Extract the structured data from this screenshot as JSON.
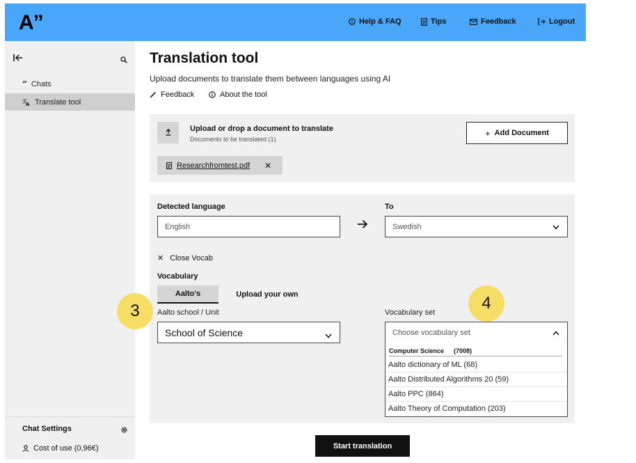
{
  "header": {
    "logo": "A”",
    "nav": {
      "help": "Help & FAQ",
      "tips": "Tips",
      "feedback": "Feedback",
      "logout": "Logout"
    },
    "color": "#4aa6f8"
  },
  "sidebar": {
    "items": [
      {
        "label": "Chats",
        "icon": "quote-icon"
      },
      {
        "label": "Translate tool",
        "icon": "translate-icon",
        "active": true
      }
    ],
    "settings_label": "Chat Settings",
    "cost_label": "Cost of use (0,96€)"
  },
  "main": {
    "title": "Translation tool",
    "subtitle": "Upload documents to translate them between languages using AI",
    "feedback_link": "Feedback",
    "about_link": "About the tool"
  },
  "upload": {
    "title": "Upload or drop a document to translate",
    "subtitle": "Documents to be translated (1)",
    "add_button": "Add Document",
    "file_name": "Researchfromtest.pdf"
  },
  "translate": {
    "detected_label": "Detected language",
    "detected_value": "English",
    "to_label": "To",
    "to_value": "Swedish",
    "close_vocab": "Close Vocab",
    "vocabulary_label": "Vocabulary",
    "tab_aalto": "Aalto's",
    "tab_upload": "Upload your own",
    "school_label": "Aalto school / Unit",
    "school_value": "School of Science",
    "vocab_set_label": "Vocabulary set",
    "vocab_set_placeholder": "Choose vocabulary set",
    "dropdown": {
      "group_name": "Computer Science",
      "group_count": "(7008)",
      "options": [
        "Aalto dictionary of ML (68)",
        "Aalto Distributed Algorithms 20 (59)",
        "Aalto PPC (864)",
        "Aalto Theory of Computation (203)"
      ]
    },
    "start_button": "Start translation"
  },
  "annotations": {
    "badge_3": "3",
    "badge_4": "4",
    "badge_color": "#f5dd66"
  }
}
